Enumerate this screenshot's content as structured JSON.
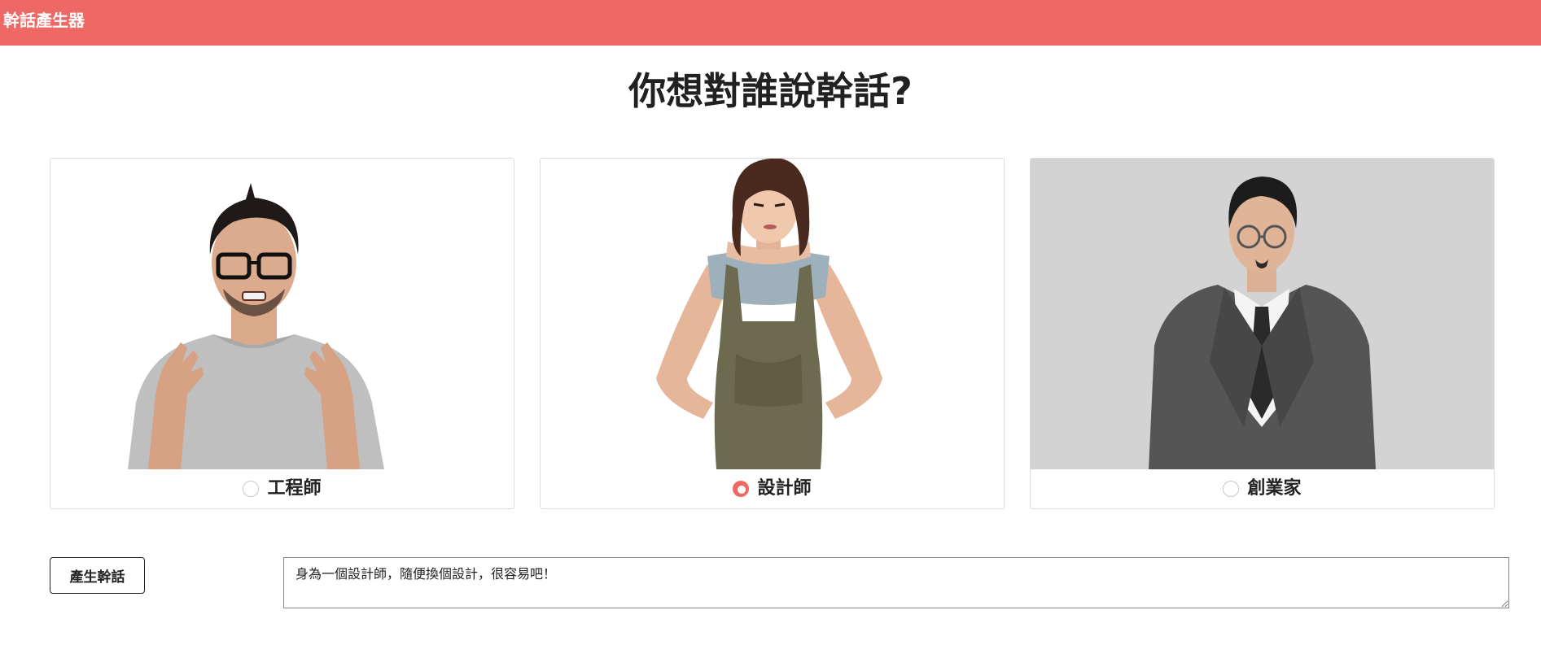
{
  "header": {
    "brand": "幹話產生器",
    "background_color": "#ee6966"
  },
  "main": {
    "title": "你想對誰說幹話?"
  },
  "targets": [
    {
      "label": "工程師",
      "checked": false,
      "photo": "angry-engineer-with-glasses-photo"
    },
    {
      "label": "設計師",
      "checked": true,
      "photo": "pouting-designer-in-apron-photo"
    },
    {
      "label": "創業家",
      "checked": false,
      "photo": "skeptical-entrepreneur-in-suit-photo"
    }
  ],
  "generator": {
    "button_label": "產生幹話",
    "result_text": "身為一個設計師，隨便換個設計，很容易吧！"
  },
  "colors": {
    "accent": "#ee6966",
    "text": "#222222",
    "border": "#dcdcdc"
  }
}
